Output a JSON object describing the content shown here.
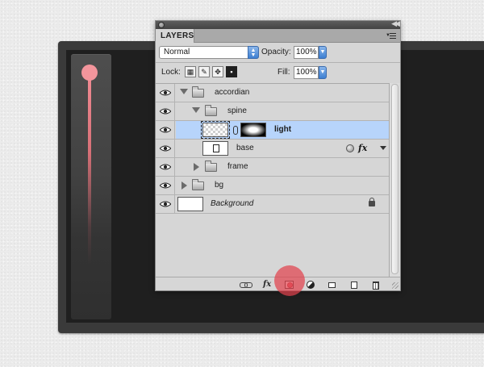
{
  "panel": {
    "tab_label": "LAYERS",
    "blend_mode": "Normal",
    "opacity_label": "Opacity:",
    "opacity_value": "100%",
    "lock_label": "Lock:",
    "fill_label": "Fill:",
    "fill_value": "100%"
  },
  "layers": [
    {
      "name": "accordian",
      "kind": "group",
      "expanded": true,
      "indent": 0,
      "visible": true
    },
    {
      "name": "spine",
      "kind": "group",
      "expanded": true,
      "indent": 1,
      "visible": true
    },
    {
      "name": "light",
      "kind": "layer-with-mask",
      "indent": 2,
      "visible": true,
      "selected": true
    },
    {
      "name": "base",
      "kind": "smart-object",
      "indent": 2,
      "visible": true,
      "has_effects": true,
      "fx_label": "fx"
    },
    {
      "name": "frame",
      "kind": "group",
      "expanded": false,
      "indent": 1,
      "visible": true
    },
    {
      "name": "bg",
      "kind": "group",
      "expanded": false,
      "indent": 0,
      "visible": true
    },
    {
      "name": "Background",
      "kind": "background",
      "indent": 0,
      "visible": true,
      "locked": true
    }
  ],
  "footer": {
    "fx_label": "fx"
  },
  "icons": {
    "visibility": "eye-icon",
    "lock_transparency": "lock-transparent-pixels-icon",
    "lock_image": "lock-image-pixels-icon",
    "lock_position": "lock-position-icon",
    "lock_all": "lock-all-icon",
    "link_layers": "link-layers-icon",
    "add_style": "add-layer-style-icon",
    "add_mask": "add-layer-mask-icon",
    "adjustment": "new-adjustment-layer-icon",
    "new_group": "new-group-icon",
    "new_layer": "new-layer-icon",
    "delete": "delete-layer-icon"
  },
  "colors": {
    "selection": "#b7d4fb",
    "accent_blue": "#3d7fd2",
    "highlight_red": "#e0424e",
    "spine_light": "#f3959c"
  }
}
